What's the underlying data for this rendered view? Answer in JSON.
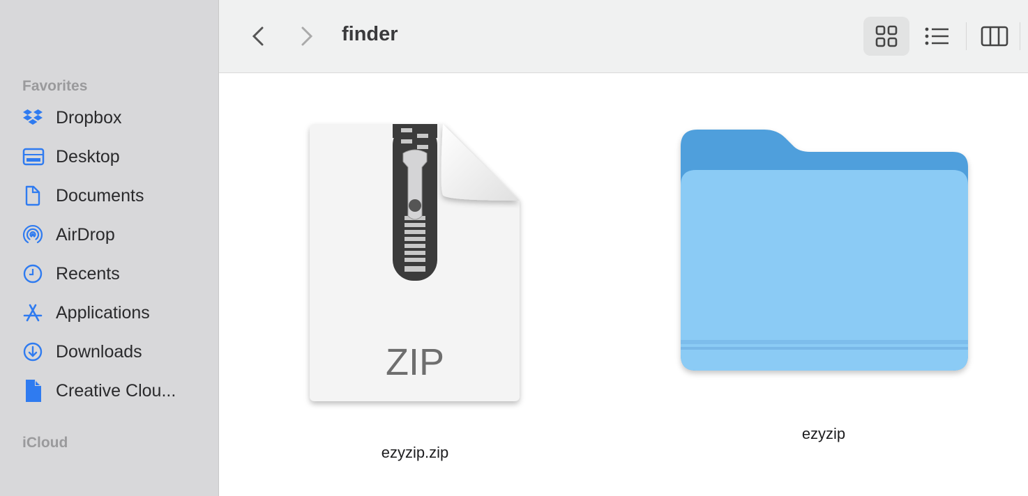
{
  "sidebar": {
    "favorites_label": "Favorites",
    "items": [
      {
        "label": "Dropbox",
        "icon": "dropbox-icon"
      },
      {
        "label": "Desktop",
        "icon": "desktop-icon"
      },
      {
        "label": "Documents",
        "icon": "document-icon"
      },
      {
        "label": "AirDrop",
        "icon": "airdrop-icon"
      },
      {
        "label": "Recents",
        "icon": "clock-icon"
      },
      {
        "label": "Applications",
        "icon": "applications-icon"
      },
      {
        "label": "Downloads",
        "icon": "download-icon"
      },
      {
        "label": "Creative Clou...",
        "icon": "file-icon"
      }
    ],
    "icloud_label": "iCloud"
  },
  "toolbar": {
    "title": "finder",
    "back_icon": "chevron-left-icon",
    "forward_icon": "chevron-right-icon",
    "views": [
      {
        "name": "icon-view",
        "active": true
      },
      {
        "name": "list-view",
        "active": false
      },
      {
        "name": "column-view",
        "active": false
      }
    ]
  },
  "files": [
    {
      "name": "ezyzip.zip",
      "type": "zip",
      "badge": "ZIP"
    },
    {
      "name": "ezyzip",
      "type": "folder"
    }
  ],
  "colors": {
    "accent": "#2f7bf0",
    "folder_front": "#8bcbf5",
    "folder_back": "#4f9fdc"
  }
}
